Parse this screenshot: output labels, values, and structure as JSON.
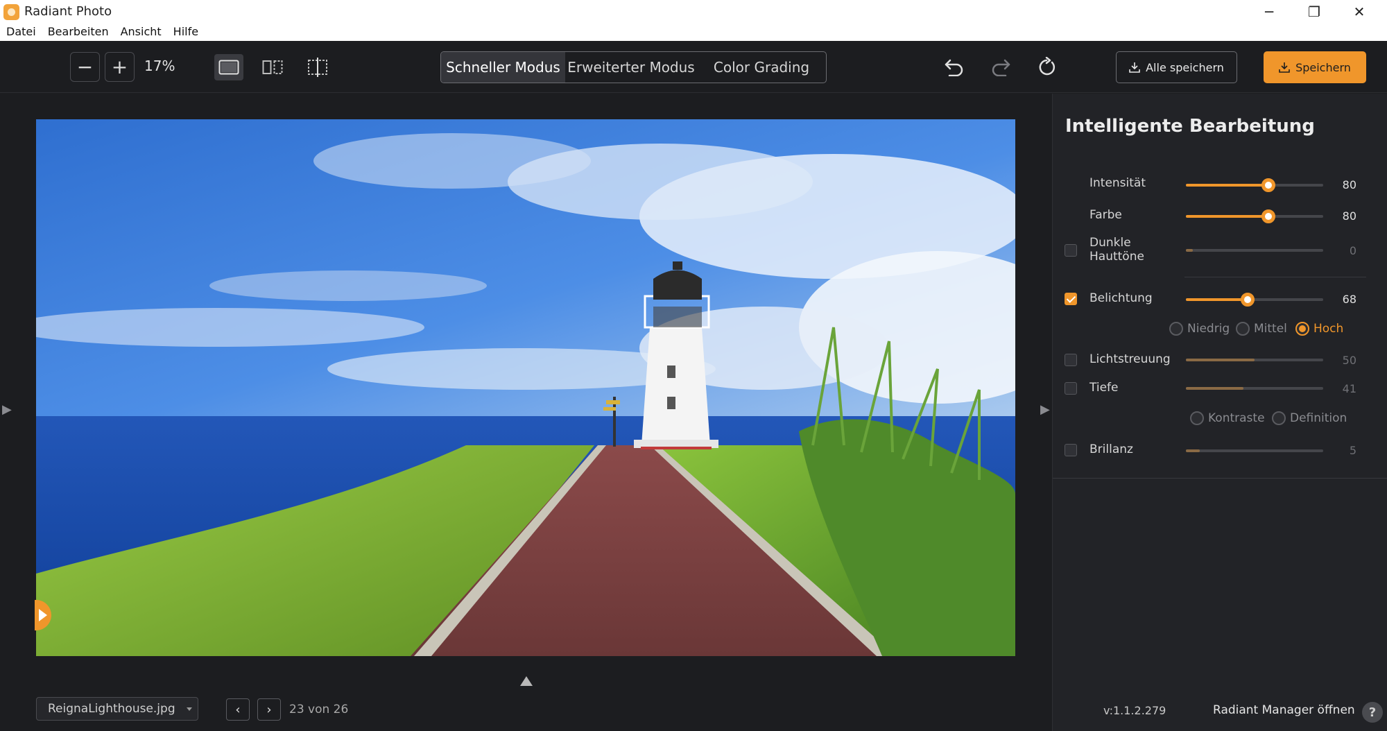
{
  "window": {
    "title": "Radiant Photo",
    "controls": {
      "minimize": "─",
      "maximize": "❐",
      "close": "✕"
    }
  },
  "menu": [
    "Datei",
    "Bearbeiten",
    "Ansicht",
    "Hilfe"
  ],
  "toolbar": {
    "zoom_out": "−",
    "zoom_in": "+",
    "zoom_level": "17%",
    "modes": [
      "Schneller Modus",
      "Erweiterter Modus",
      "Color Grading"
    ],
    "active_mode": "Schneller Modus",
    "save_all_label": "Alle speichern",
    "save_label": "Speichern"
  },
  "canvas": {
    "file_name": "ReignaLighthouse.jpg",
    "prev": "‹",
    "next": "›",
    "counter": "23 von 26",
    "left_arrow": "▶",
    "right_arrow": "▶"
  },
  "panel": {
    "title": "Intelligente Bearbeitung",
    "controls": [
      {
        "label": "Intensität",
        "value": "80",
        "level": 80
      },
      {
        "label": "Farbe",
        "value": "80",
        "level": 80
      },
      {
        "label_line1": "Dunkle",
        "label_line2": "Hauttöne",
        "value": "0",
        "level": 0
      },
      {
        "label": "Belichtung",
        "value": "68",
        "level": 68
      },
      {
        "label": "Lichtstreuung",
        "value": "50",
        "level": 50
      },
      {
        "label": "Tiefe",
        "value": "41",
        "level": 41
      },
      {
        "label": "Brillanz",
        "value": "5",
        "level": 5
      }
    ],
    "exposure_options": [
      "Niedrig",
      "Mittel",
      "Hoch"
    ],
    "exposure_selected": "Hoch",
    "depth_options": [
      "Kontraste",
      "Definition"
    ],
    "version": "v:1.1.2.279",
    "manager_link": "Radiant Manager öffnen",
    "help": "?"
  },
  "colors": {
    "accent": "#f0962b",
    "background": "#1c1d20",
    "panel": "#222327"
  }
}
